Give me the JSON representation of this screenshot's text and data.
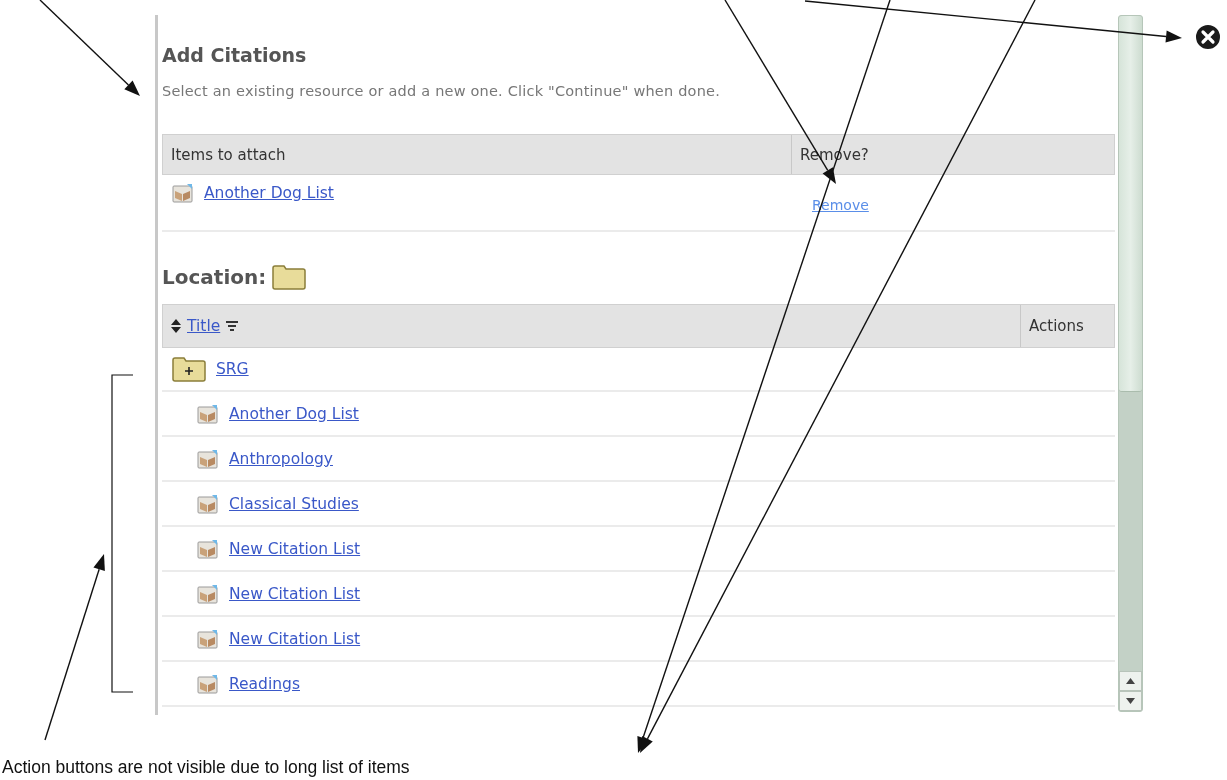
{
  "dialog": {
    "title": "Add Citations",
    "instructions": "Select an existing resource or add a new one. Click \"Continue\" when done.",
    "attach_table": {
      "columns": [
        "Items to attach",
        "Remove?"
      ],
      "rows": [
        {
          "title": "Another Dog List",
          "action": "Remove"
        }
      ]
    },
    "location": {
      "label": "Location:"
    },
    "resource_table": {
      "columns": [
        "Title",
        "Actions"
      ],
      "rows": [
        {
          "kind": "folder",
          "title": "SRG",
          "children": [
            {
              "kind": "list",
              "title": "Another Dog List"
            },
            {
              "kind": "list",
              "title": "Anthropology"
            },
            {
              "kind": "list",
              "title": "Classical Studies"
            },
            {
              "kind": "list",
              "title": "New Citation List"
            },
            {
              "kind": "list",
              "title": "New Citation List"
            },
            {
              "kind": "list",
              "title": "New Citation List"
            },
            {
              "kind": "list",
              "title": "Readings"
            }
          ]
        }
      ]
    }
  },
  "annotation": {
    "caption": "Action buttons are not visible due to long list of items"
  }
}
